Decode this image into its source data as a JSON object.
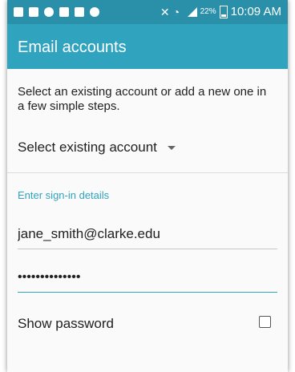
{
  "status_bar": {
    "battery_percent": "22%",
    "time": "10:09 AM",
    "icons": [
      "message-icon",
      "facebook-icon",
      "location-icon",
      "gallery-icon",
      "app-icon",
      "app-icon-2",
      "mute-icon",
      "wifi-icon",
      "signal-icon",
      "battery-icon"
    ]
  },
  "app_bar": {
    "title": "Email accounts"
  },
  "content": {
    "intro": "Select an existing account or add a new one in a few simple steps.",
    "select_existing_label": "Select existing account",
    "section_label": "Enter sign-in details",
    "email_value": "jane_smith@clarke.edu",
    "password_value": "••••••••••••••",
    "show_password_label": "Show password",
    "show_password_checked": false
  },
  "colors": {
    "status_bar": "#2a8fa8",
    "app_bar": "#30a4bf",
    "accent": "#30a4bf"
  }
}
